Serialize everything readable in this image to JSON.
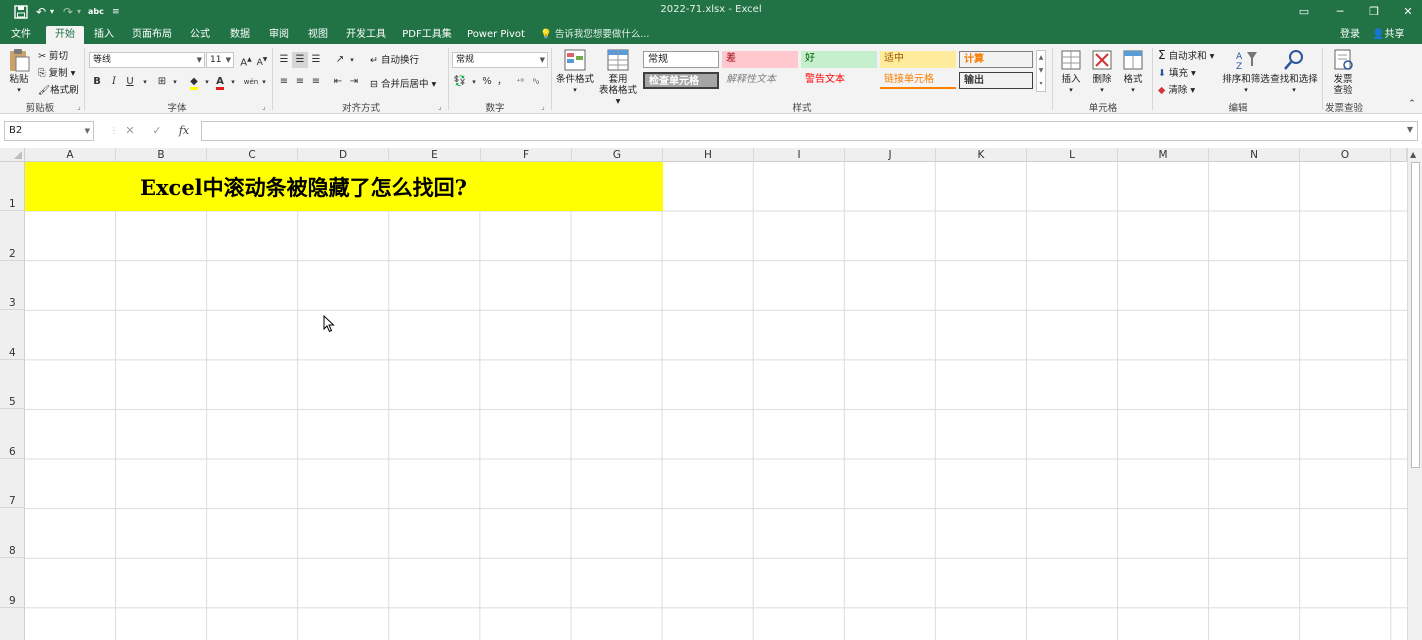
{
  "titlebar": {
    "title": "2022-71.xlsx - Excel",
    "undo_glyph": "↶",
    "redo_glyph": "↷",
    "spell_label": "abc"
  },
  "tabs": [
    "文件",
    "开始",
    "插入",
    "页面布局",
    "公式",
    "数据",
    "审阅",
    "视图",
    "开发工具",
    "PDF工具集",
    "Power Pivot"
  ],
  "active_tab": "开始",
  "tell_me": "告诉我您想要做什么...",
  "account": {
    "login": "登录",
    "share": "共享"
  },
  "ribbon": {
    "clipboard": {
      "paste": "粘贴",
      "cut": "剪切",
      "copy": "复制",
      "format_painter": "格式刷",
      "label": "剪贴板"
    },
    "font": {
      "name": "等线",
      "size": "11",
      "grow": "A",
      "shrink": "A",
      "bold": "B",
      "italic": "I",
      "underline": "U",
      "wen": "wén",
      "label": "字体"
    },
    "alignment": {
      "wrap": "自动换行",
      "merge": "合并后居中",
      "label": "对齐方式"
    },
    "number": {
      "format": "常规",
      "percent": "%",
      "comma": "，",
      "label": "数字"
    },
    "styles": {
      "conditional": [
        "条件格式"
      ],
      "table_format": [
        "套用",
        "表格格式"
      ],
      "boxes": [
        "常规",
        "差",
        "好",
        "适中",
        "计算",
        "检查单元格",
        "解释性文本",
        "警告文本",
        "链接单元格",
        "输出"
      ],
      "label": "样式"
    },
    "cells": {
      "insert": "插入",
      "delete": "删除",
      "format": "格式",
      "label": "单元格"
    },
    "editing": {
      "autosum": "自动求和",
      "fill": "填充",
      "clear": "清除",
      "sort": "排序和筛选",
      "find": "查找和选择",
      "label": "编辑"
    },
    "invoice": {
      "btn1": "发票",
      "btn2": "查验",
      "label": "发票查验"
    }
  },
  "formula_bar": {
    "name_box": "B2",
    "cancel": "✕",
    "enter": "✓",
    "fx": "fx",
    "formula": ""
  },
  "columns": [
    "A",
    "B",
    "C",
    "D",
    "E",
    "F",
    "G",
    "H",
    "I",
    "J",
    "K",
    "L",
    "M",
    "N",
    "O"
  ],
  "rows": [
    "1",
    "2",
    "3",
    "4",
    "5",
    "6",
    "7",
    "8",
    "9"
  ],
  "cells": {
    "A1": "Excel中滚动条被隐藏了怎么找回?"
  }
}
